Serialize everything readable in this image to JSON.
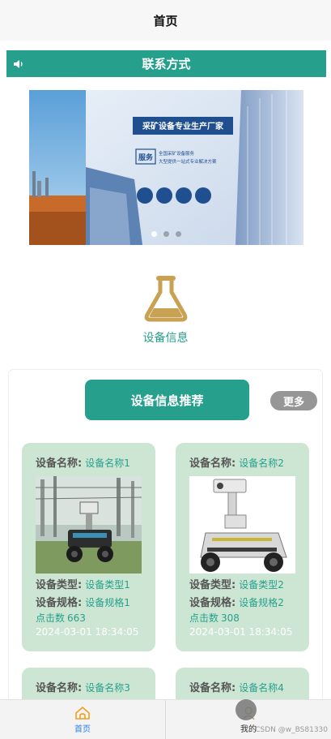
{
  "header": {
    "title": "首页"
  },
  "notice": {
    "icon": "speaker-icon",
    "text": "联系方式"
  },
  "banner": {
    "headline": "采矿设备专业生产厂家",
    "service_badge": "服务",
    "service_line1": "全国采矿设备服务",
    "service_line2": "大型提供一站式专业解决方案",
    "slide_count": 3,
    "active_slide": 1
  },
  "category": {
    "icon": "flask-icon",
    "label": "设备信息"
  },
  "recommend": {
    "title": "设备信息推荐",
    "more_label": "更多",
    "field_labels": {
      "name": "设备名称:",
      "type": "设备类型:",
      "spec": "设备规格:",
      "clicks": "点击数"
    },
    "cards": [
      {
        "name": "设备名称1",
        "type": "设备类型1",
        "spec": "设备规格1",
        "clicks": "663",
        "date": "2024-03-01 18:34:05",
        "image": "inspection-robot-substation"
      },
      {
        "name": "设备名称2",
        "type": "设备类型2",
        "spec": "设备规格2",
        "clicks": "308",
        "date": "2024-03-01 18:34:05",
        "image": "inspection-robot-white"
      },
      {
        "name": "设备名称3"
      },
      {
        "name": "设备名称4"
      }
    ]
  },
  "tabbar": {
    "items": [
      {
        "label": "首页",
        "icon": "home-icon",
        "active": true
      },
      {
        "label": "我的",
        "icon": "user-icon",
        "active": false
      }
    ],
    "watermark": "CSDN @w_BS81330"
  },
  "colors": {
    "accent": "#26a08c",
    "card_bg": "#cde6d3",
    "category_icon": "#c8a152",
    "more_bg": "#969696",
    "tab_active": "#2a7ef0"
  }
}
